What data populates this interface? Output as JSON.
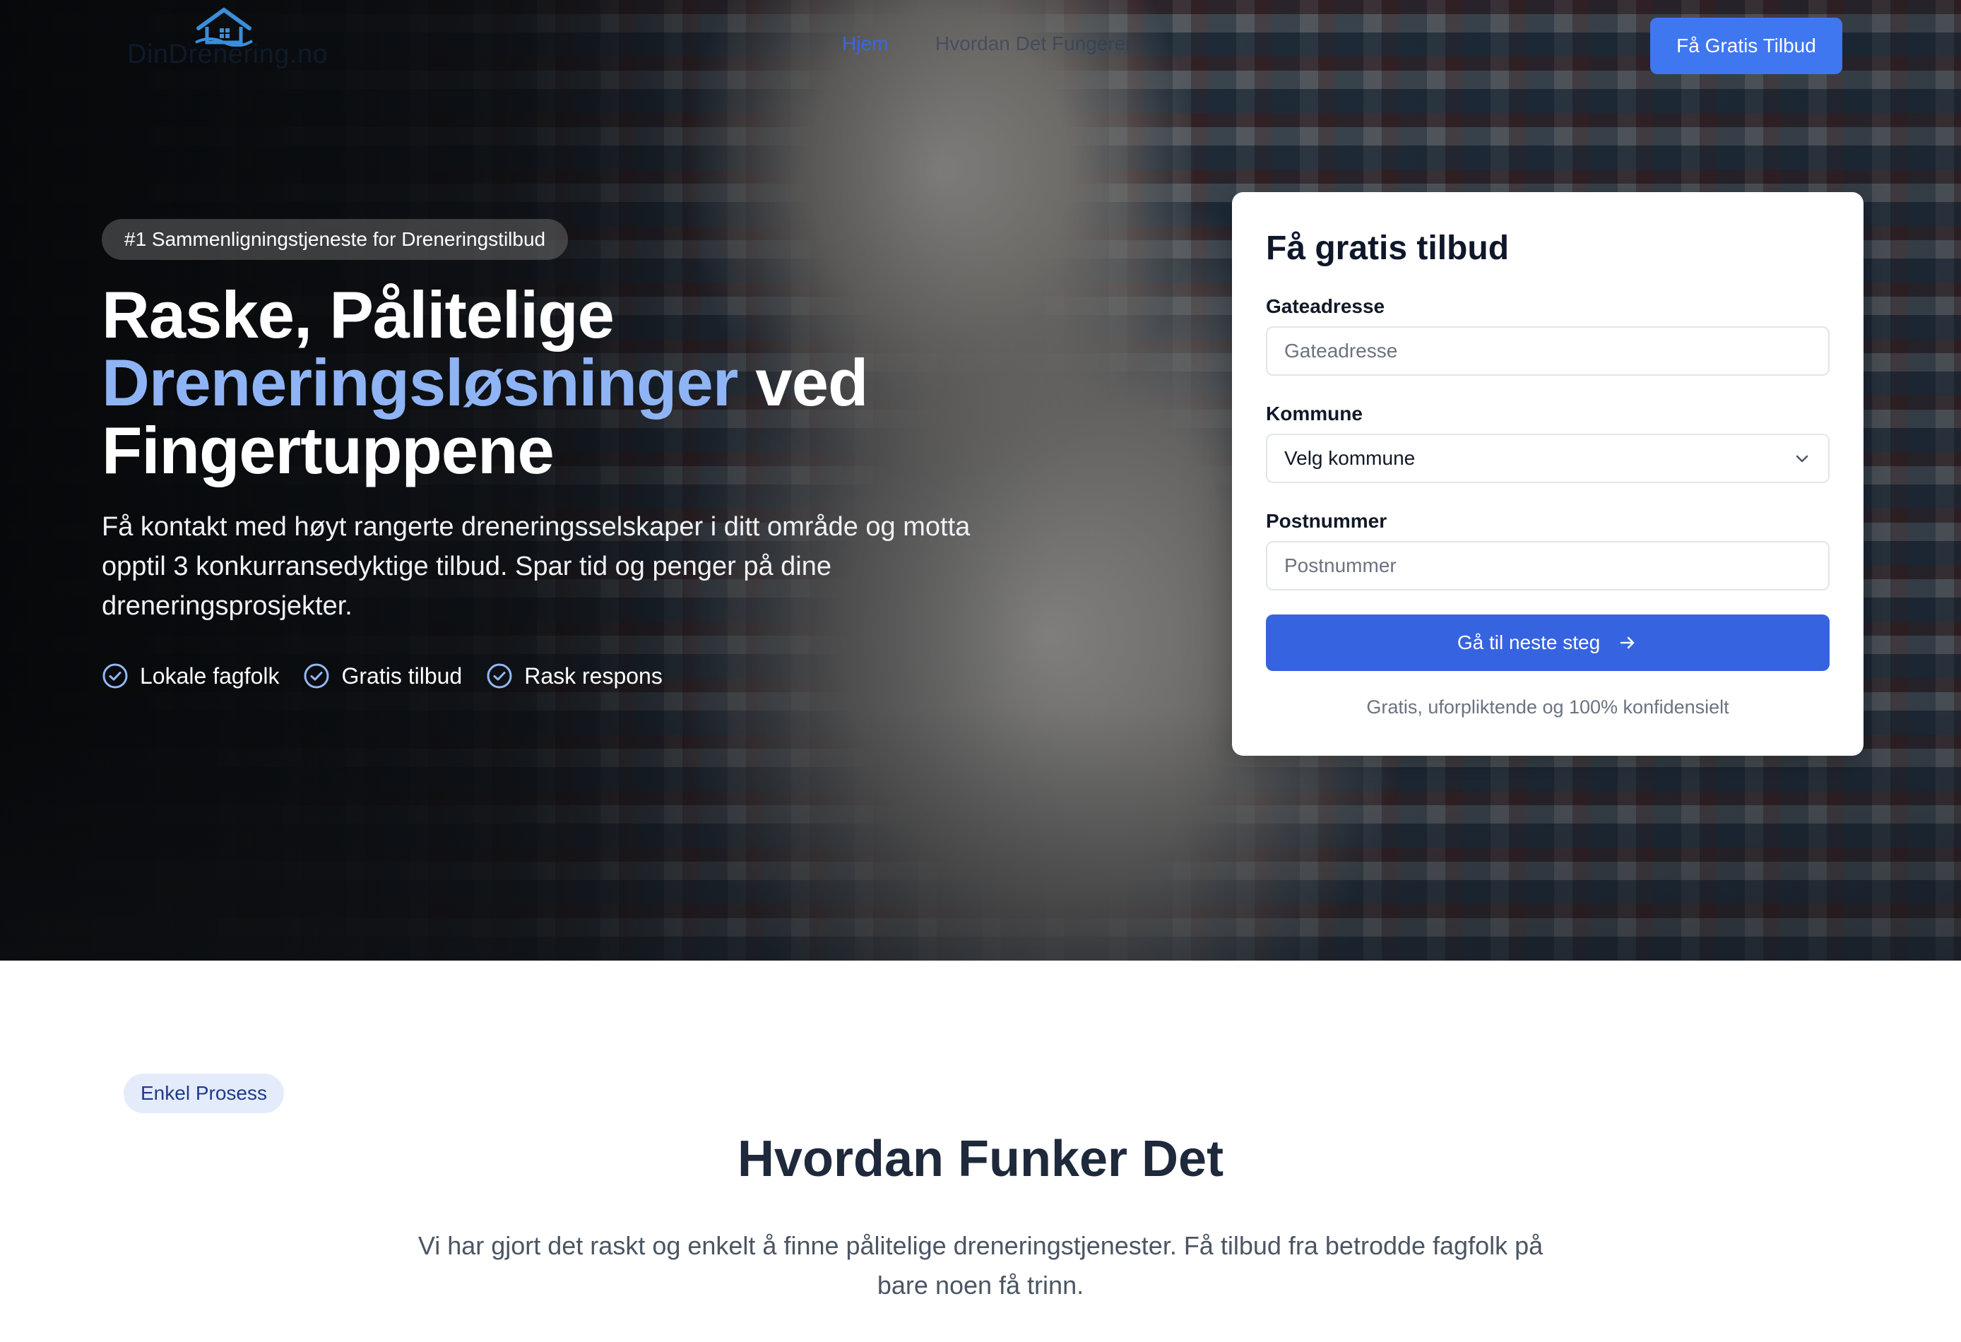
{
  "nav": {
    "logo_text": "DinDrenering.no",
    "links": [
      {
        "label": "Hjem"
      },
      {
        "label": "Hvordan Det Fungerer"
      }
    ],
    "cta_label": "Få Gratis Tilbud"
  },
  "hero": {
    "badge": "#1 Sammenligningstjeneste for Dreneringstilbud",
    "headline_part1": "Raske, Pålitelige",
    "headline_accent": "Dreneringsløsninger",
    "headline_part2": " ved",
    "headline_part3": "Fingertuppene",
    "subtext": "Få kontakt med høyt rangerte dreneringsselskaper i ditt område og motta opptil 3 konkurransedyktige tilbud. Spar tid og penger på dine dreneringsprosjekter.",
    "features": [
      {
        "label": "Lokale fagfolk",
        "icon": "check-circle-icon"
      },
      {
        "label": "Gratis tilbud",
        "icon": "check-circle-icon"
      },
      {
        "label": "Rask respons",
        "icon": "check-circle-icon"
      }
    ]
  },
  "form": {
    "title": "Få gratis tilbud",
    "street_label": "Gateadresse",
    "street_placeholder": "Gateadresse",
    "street_value": "",
    "municipality_label": "Kommune",
    "municipality_selected": "Velg kommune",
    "postcode_label": "Postnummer",
    "postcode_placeholder": "Postnummer",
    "postcode_value": "",
    "submit_label": "Gå til neste steg",
    "note": "Gratis, uforpliktende og 100% konfidensielt"
  },
  "how": {
    "badge": "Enkel Prosess",
    "title": "Hvordan Funker Det",
    "text": "Vi har gjort det raskt og enkelt å finne pålitelige dreneringstjenester. Få tilbud fra betrodde fagfolk på bare noen få trinn."
  },
  "colors": {
    "primary": "#3663e0",
    "nav_cta": "#3f77f0",
    "accent_text": "#8fb4f5",
    "badge_bg": "#e4ecfb",
    "heading": "#1e293b"
  }
}
